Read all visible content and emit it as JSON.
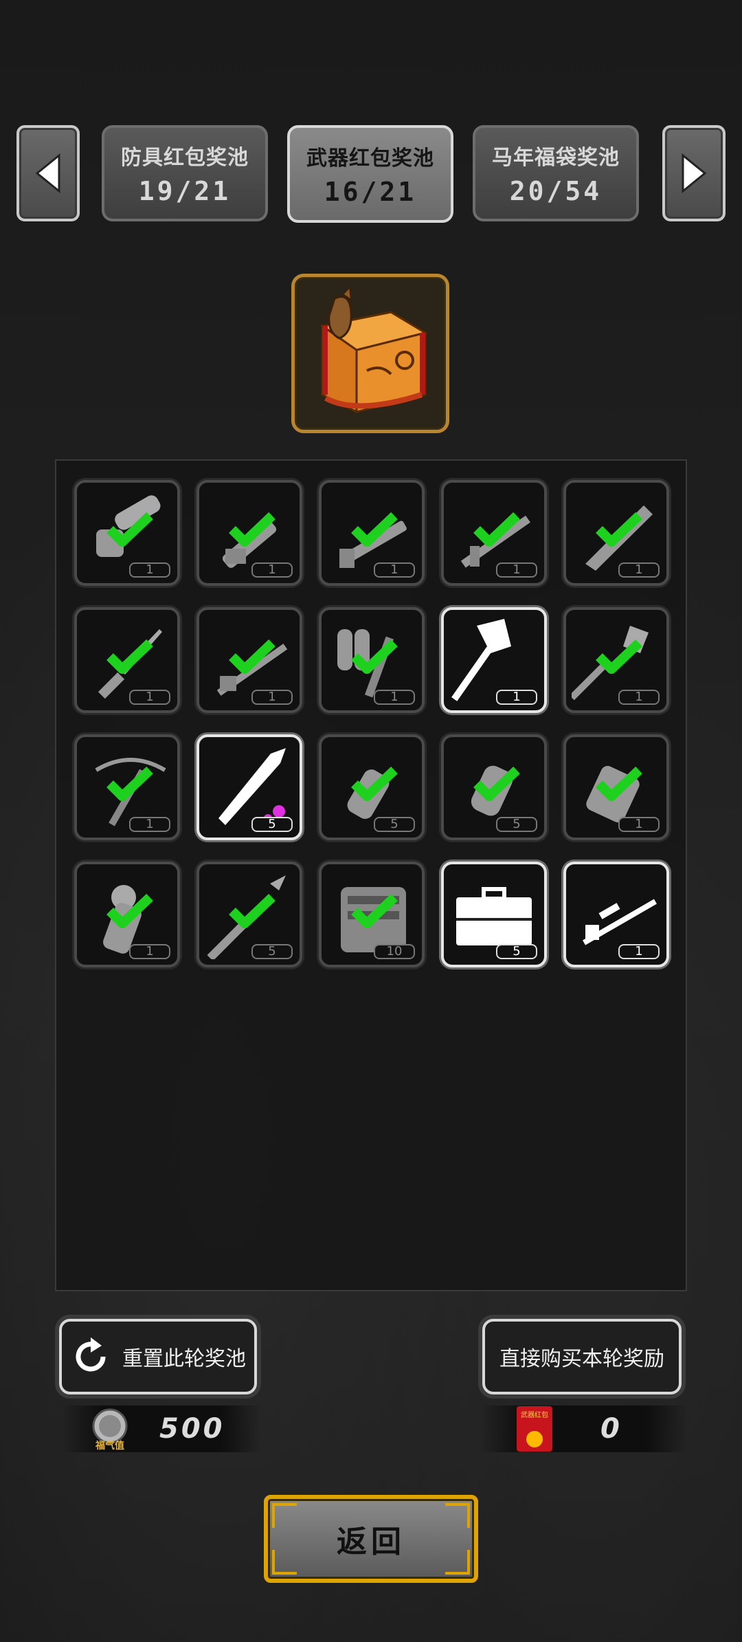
{
  "tabs": [
    {
      "name": "防具红包奖池",
      "count": "19/21",
      "active": false
    },
    {
      "name": "武器红包奖池",
      "count": "16/21",
      "active": true
    },
    {
      "name": "马年福袋奖池",
      "count": "20/54",
      "active": false
    }
  ],
  "items": [
    {
      "icon": "chainsaw-icon",
      "qty": "1",
      "claimed": true
    },
    {
      "icon": "minigun-icon",
      "qty": "1",
      "claimed": true
    },
    {
      "icon": "shotgun-icon",
      "qty": "1",
      "claimed": true
    },
    {
      "icon": "assault-rifle-icon",
      "qty": "1",
      "claimed": true
    },
    {
      "icon": "machete-icon",
      "qty": "1",
      "claimed": true
    },
    {
      "icon": "bayonet-icon",
      "qty": "1",
      "claimed": true
    },
    {
      "icon": "rifle-icon",
      "qty": "1",
      "claimed": true
    },
    {
      "icon": "flamethrower-icon",
      "qty": "1",
      "claimed": true
    },
    {
      "icon": "fire-axe-icon",
      "qty": "1",
      "claimed": false
    },
    {
      "icon": "shovel-icon",
      "qty": "1",
      "claimed": true
    },
    {
      "icon": "crossbow-icon",
      "qty": "1",
      "claimed": true
    },
    {
      "icon": "bullet-icon",
      "qty": "5",
      "claimed": false
    },
    {
      "icon": "grenade-icon",
      "qty": "5",
      "claimed": true
    },
    {
      "icon": "frag-grenade-icon",
      "qty": "5",
      "claimed": true
    },
    {
      "icon": "dynamite-icon",
      "qty": "1",
      "claimed": true
    },
    {
      "icon": "smoke-grenade-icon",
      "qty": "1",
      "claimed": true
    },
    {
      "icon": "rocket-icon",
      "qty": "5",
      "claimed": true
    },
    {
      "icon": "toolkit-icon",
      "qty": "10",
      "claimed": true
    },
    {
      "icon": "toolbox-icon",
      "qty": "5",
      "claimed": false
    },
    {
      "icon": "sniper-rifle-icon",
      "qty": "1",
      "claimed": false
    }
  ],
  "actions": {
    "reset_label": "重置此轮奖池",
    "buy_label": "直接购买本轮奖励"
  },
  "currency": {
    "luck_label": "福气值",
    "luck_amount": "500",
    "redpacket_label": "武器红包",
    "redpacket_amount": "0"
  },
  "back_label": "返回",
  "colors": {
    "check": "#1fd11f",
    "gold": "#e0a400"
  }
}
